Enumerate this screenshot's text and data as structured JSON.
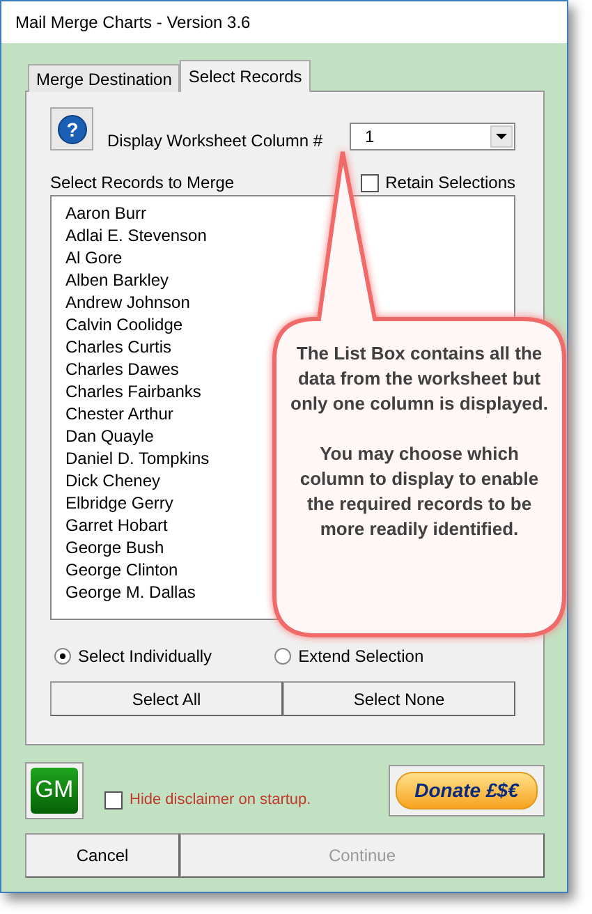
{
  "window": {
    "title": "Mail Merge Charts - Version 3.6"
  },
  "tabs": [
    {
      "label": "Merge Destination",
      "selected": false
    },
    {
      "label": "Select Records",
      "selected": true
    }
  ],
  "help_button": {
    "label": "?"
  },
  "column_picker": {
    "label": "Display Worksheet Column #",
    "value": "1"
  },
  "records_label": "Select Records to Merge",
  "retain_selections": {
    "label": "Retain Selections",
    "checked": false
  },
  "records": [
    "Aaron Burr",
    "Adlai E. Stevenson",
    "Al Gore",
    "Alben Barkley",
    "Andrew Johnson",
    "Calvin Coolidge",
    "Charles Curtis",
    "Charles Dawes",
    "Charles Fairbanks",
    "Chester Arthur",
    "Dan Quayle",
    "Daniel D. Tompkins",
    "Dick Cheney",
    "Elbridge Gerry",
    "Garret Hobart",
    "George Bush",
    "George Clinton",
    "George M. Dallas"
  ],
  "selection_modes": [
    {
      "label": "Select Individually",
      "selected": true
    },
    {
      "label": "Extend Selection",
      "selected": false
    }
  ],
  "select_buttons": [
    "Select All",
    "Select None"
  ],
  "logo": {
    "text": "GM"
  },
  "hide_disclaimer": {
    "label": "Hide disclaimer on startup.",
    "checked": false
  },
  "donate_button": {
    "label": "Donate £$€"
  },
  "buttons": [
    {
      "label": "Cancel",
      "disabled": false
    },
    {
      "label": "Continue",
      "disabled": true
    }
  ],
  "callout": {
    "paragraphs": [
      "The List Box contains all the data from the worksheet but only one column is displayed.",
      "You may choose which column to display to enable the required records to be more readily identified."
    ]
  }
}
